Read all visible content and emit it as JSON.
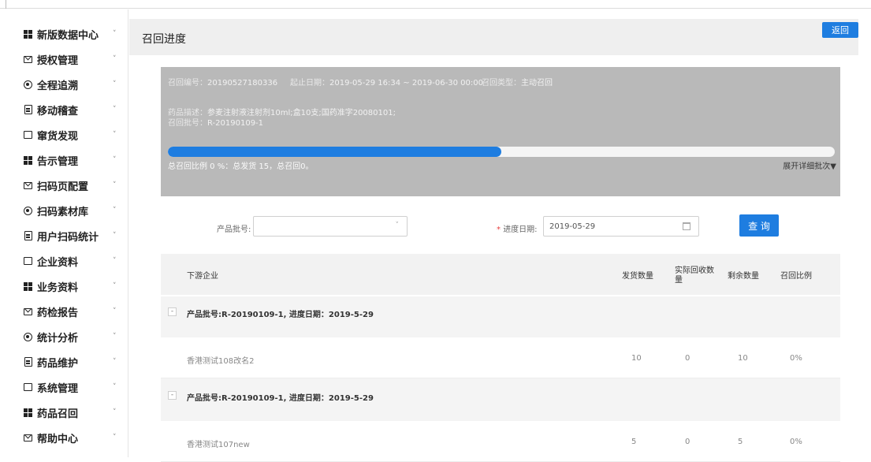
{
  "sidebar": {
    "items": [
      {
        "label": "新版数据中心",
        "icon": "grid"
      },
      {
        "label": "授权管理",
        "icon": "mail"
      },
      {
        "label": "全程追溯",
        "icon": "target"
      },
      {
        "label": "移动稽查",
        "icon": "doc"
      },
      {
        "label": "窜货发现",
        "icon": "folder"
      },
      {
        "label": "告示管理",
        "icon": "grid"
      },
      {
        "label": "扫码页配置",
        "icon": "mail"
      },
      {
        "label": "扫码素材库",
        "icon": "target"
      },
      {
        "label": "用户扫码统计",
        "icon": "doc"
      },
      {
        "label": "企业资料",
        "icon": "folder"
      },
      {
        "label": "业务资料",
        "icon": "grid"
      },
      {
        "label": "药检报告",
        "icon": "mail"
      },
      {
        "label": "统计分析",
        "icon": "target"
      },
      {
        "label": "药品维护",
        "icon": "doc"
      },
      {
        "label": "系统管理",
        "icon": "folder"
      },
      {
        "label": "药品召回",
        "icon": "grid"
      },
      {
        "label": "帮助中心",
        "icon": "mail"
      }
    ],
    "chevron": "˅"
  },
  "header": {
    "title": "召回进度",
    "back_label": "返回"
  },
  "info": {
    "recall_no_label": "召回编号：",
    "recall_no": "20190527180336",
    "date_label": "起止日期：",
    "date_range": "2019-05-29 16:34 ~ 2019-06-30 00:00",
    "type_label": "召回类型：",
    "type": "主动召回",
    "desc_label": "药品描述：",
    "desc": "参麦注射液注射剂10ml;盒10支;国药准字20080101;",
    "batch_label": "召回批号：",
    "batch": "R-20190109-1",
    "progress_fraction": 0.5,
    "summary": "总召回比例 0 %：总发货 15，总召回0。",
    "expand_label": "展开详细批次▼"
  },
  "filters": {
    "batch_label": "产品批号:",
    "batch_value": "",
    "date_required_mark": "*",
    "date_label": "进度日期:",
    "date_value": "2019-05-29",
    "query_label": "查 询"
  },
  "table": {
    "columns": {
      "company": "下游企业",
      "shipped": "发货数量",
      "recovered_line1": "实际回收数",
      "recovered_line2": "量",
      "remaining": "剩余数量",
      "ratio": "召回比例"
    },
    "groups": [
      {
        "toggle": "-",
        "label": "产品批号:R-20190109-1, 进度日期：2019-5-29",
        "rows": [
          {
            "company": "香港测试108改名2",
            "shipped": "10",
            "recovered": "0",
            "remaining": "10",
            "ratio": "0%"
          }
        ]
      },
      {
        "toggle": "-",
        "label": "产品批号:R-20190109-1, 进度日期：2019-5-29",
        "rows": [
          {
            "company": "香港测试107new",
            "shipped": "5",
            "recovered": "0",
            "remaining": "5",
            "ratio": "0%"
          }
        ]
      }
    ]
  },
  "colors": {
    "accent": "#1e7de0",
    "panel": "#b9b9b9",
    "required": "#e84040"
  }
}
